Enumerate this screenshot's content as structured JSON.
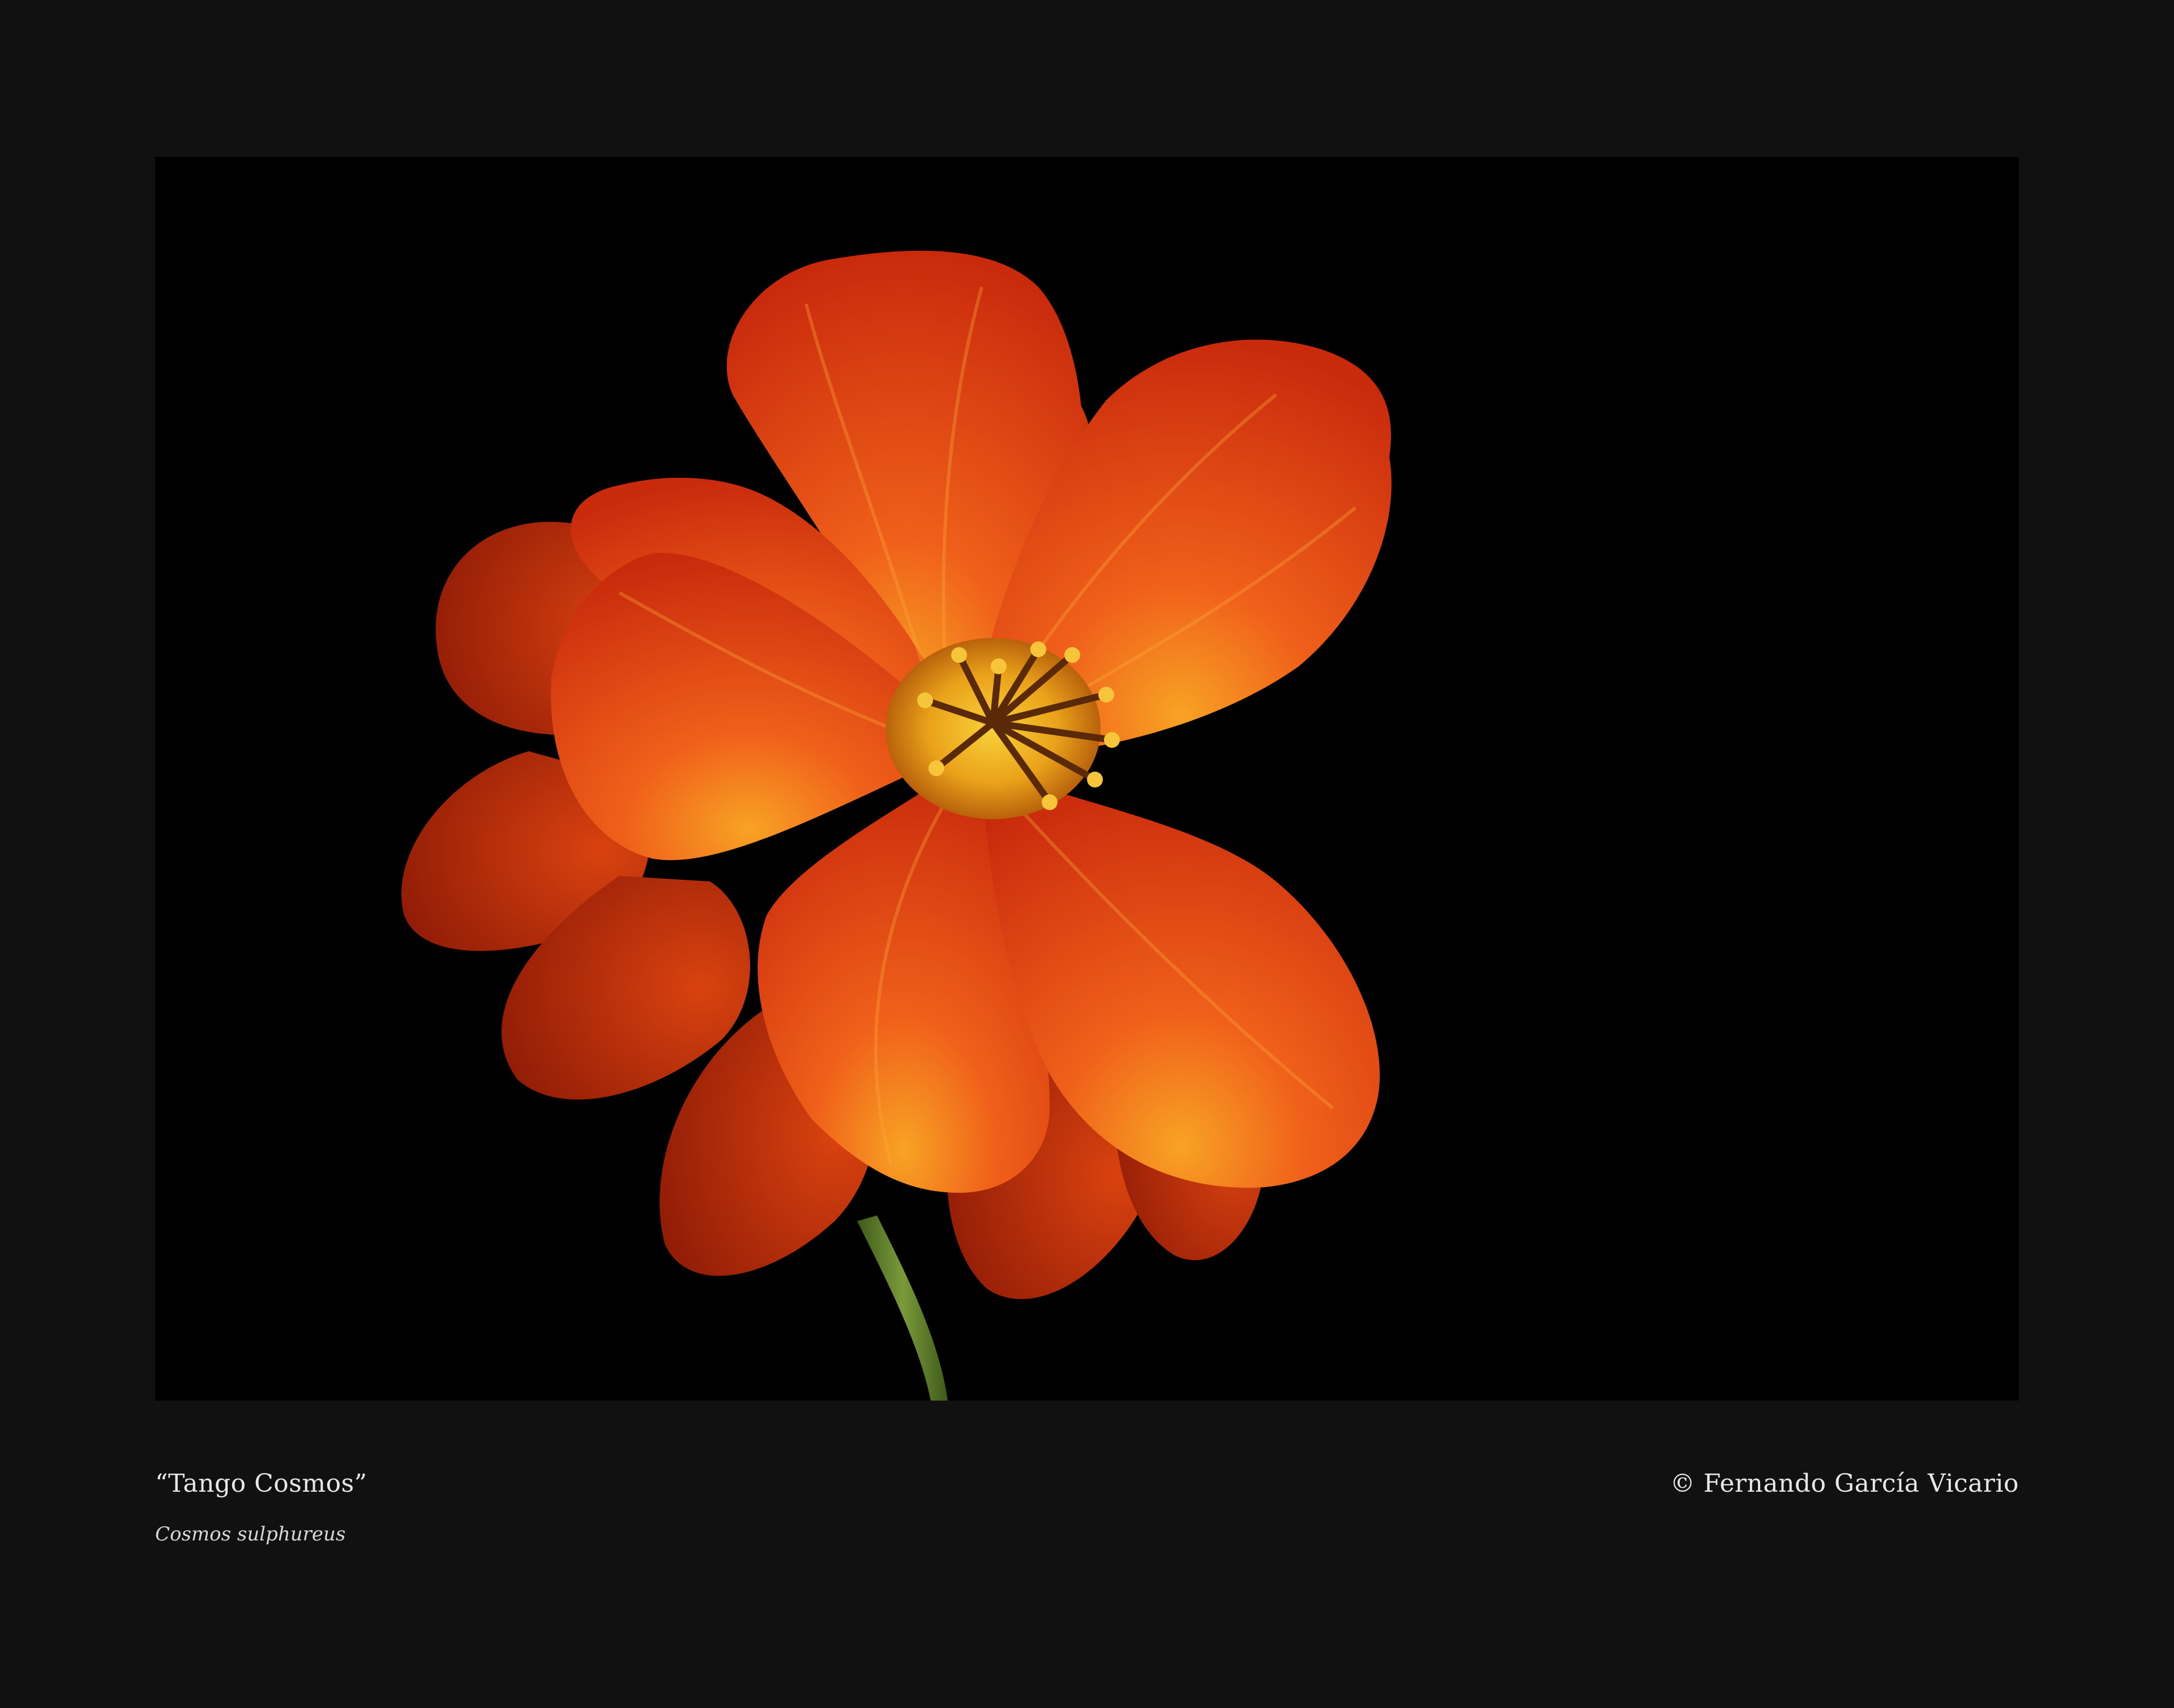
{
  "caption": {
    "title": "“Tango Cosmos”",
    "subtitle": "Cosmos sulphureus",
    "credit": "© Fernando García Vicario"
  },
  "photo": {
    "subject": "orange-cosmos-flower-icon",
    "colors": {
      "background": "#111111",
      "photo_background": "#000000",
      "petal_dark": "#b8220a",
      "petal_mid": "#e8440f",
      "petal_light": "#f7861c",
      "center": "#f2b21c",
      "stamen": "#5a2a08",
      "stem": "#5c7a2a"
    }
  }
}
